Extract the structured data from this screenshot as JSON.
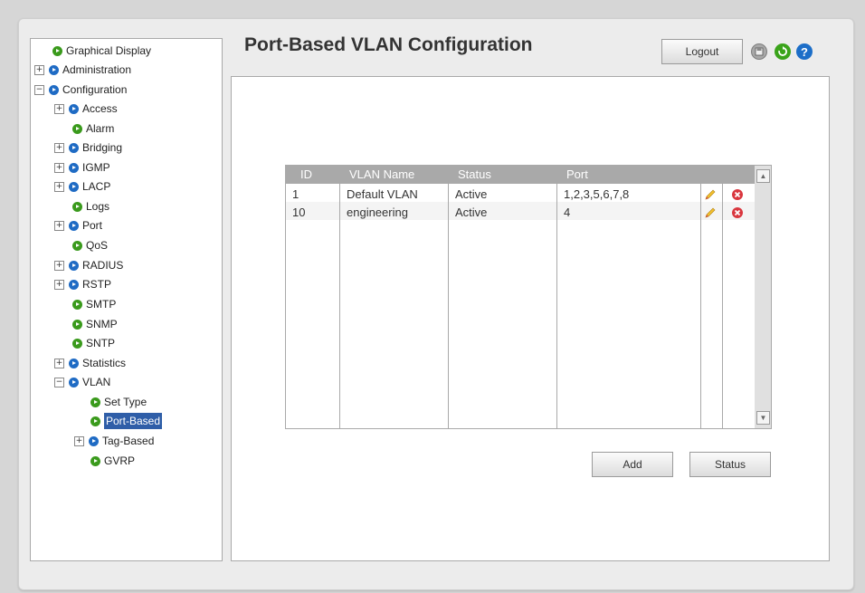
{
  "page": {
    "title": "Port-Based VLAN Configuration"
  },
  "header": {
    "logout_label": "Logout",
    "icons": [
      "save-icon",
      "refresh-icon",
      "help-icon"
    ],
    "colors": {
      "refresh": "#3aa31a",
      "help": "#1c6ec8"
    }
  },
  "nav": {
    "items": [
      {
        "label": "Graphical Display",
        "expander": ""
      },
      {
        "label": "Administration",
        "expander": "+"
      },
      {
        "label": "Configuration",
        "expander": "−"
      },
      {
        "label": "Access",
        "expander": "+"
      },
      {
        "label": "Alarm",
        "expander": ""
      },
      {
        "label": "Bridging",
        "expander": "+"
      },
      {
        "label": "IGMP",
        "expander": "+"
      },
      {
        "label": "LACP",
        "expander": "+"
      },
      {
        "label": "Logs",
        "expander": ""
      },
      {
        "label": "Port",
        "expander": "+"
      },
      {
        "label": "QoS",
        "expander": ""
      },
      {
        "label": "RADIUS",
        "expander": "+"
      },
      {
        "label": "RSTP",
        "expander": "+"
      },
      {
        "label": "SMTP",
        "expander": ""
      },
      {
        "label": "SNMP",
        "expander": ""
      },
      {
        "label": "SNTP",
        "expander": ""
      },
      {
        "label": "Statistics",
        "expander": "+"
      },
      {
        "label": "VLAN",
        "expander": "−"
      },
      {
        "label": "Set Type",
        "expander": ""
      },
      {
        "label": "Port-Based",
        "expander": ""
      },
      {
        "label": "Tag-Based",
        "expander": "+"
      },
      {
        "label": "GVRP",
        "expander": ""
      }
    ],
    "selected": "Port-Based"
  },
  "table": {
    "headers": [
      "ID",
      "VLAN Name",
      "Status",
      "Port"
    ],
    "rows": [
      {
        "id": "1",
        "name": "Default VLAN",
        "status": "Active",
        "port": "1,2,3,5,6,7,8"
      },
      {
        "id": "10",
        "name": "engineering",
        "status": "Active",
        "port": "4"
      }
    ]
  },
  "actions": {
    "add_label": "Add",
    "status_label": "Status"
  }
}
